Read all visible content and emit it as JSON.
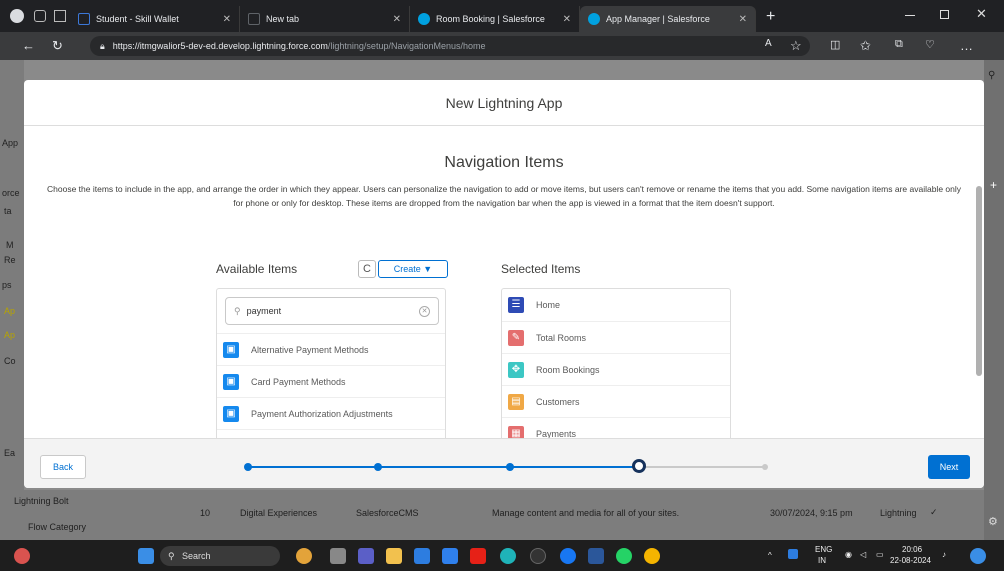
{
  "browser": {
    "tabs": [
      {
        "title": "Student - Skill Wallet",
        "color": "#3c78d8"
      },
      {
        "title": "New tab",
        "color": "#5f6368"
      },
      {
        "title": "Room Booking | Salesforce",
        "color": "#00a1e0"
      },
      {
        "title": "App Manager | Salesforce",
        "color": "#00a1e0"
      }
    ],
    "new_tab": "+",
    "url_host": "https://itmgwalior5-dev-ed.develop.lightning.force.com",
    "url_path": "/lightning/setup/NavigationMenus/home"
  },
  "modal": {
    "title": "New Lightning App",
    "section_title": "Navigation Items",
    "description": "Choose the items to include in the app, and arrange the order in which they appear. Users can personalize the navigation to add or move items, but users can't remove or rename the items that you add. Some navigation items are available only for phone or only for desktop. These items are dropped from the navigation bar when the app is viewed in a format that the item doesn't support.",
    "available_label": "Available Items",
    "refresh_glyph": "C",
    "create_label": "Create ▼",
    "search_value": "payment",
    "available_items": [
      {
        "label": "Alternative Payment Methods",
        "color": "#1589ee"
      },
      {
        "label": "Card Payment Methods",
        "color": "#1589ee"
      },
      {
        "label": "Payment Authorization Adjustments",
        "color": "#1589ee"
      }
    ],
    "selected_label": "Selected Items",
    "selected_items": [
      {
        "label": "Home",
        "color": "#2e4bb5",
        "glyph": "☰"
      },
      {
        "label": "Total Rooms",
        "color": "#e46e6e",
        "glyph": "✎"
      },
      {
        "label": "Room Bookings",
        "color": "#3cc7c4",
        "glyph": "✥"
      },
      {
        "label": "Customers",
        "color": "#f0a845",
        "glyph": "▤"
      },
      {
        "label": "Payments",
        "color": "#e46e6e",
        "glyph": "▦"
      }
    ],
    "back_label": "Back",
    "next_label": "Next"
  },
  "background": {
    "left_labels": [
      "App",
      "orce",
      "ta",
      "M",
      "Re",
      "ps",
      "Ap",
      "Ap",
      "Co",
      "Ea"
    ],
    "lightning_bolt": "Lightning Bolt",
    "flow_category": "Flow Category",
    "row_num": "10",
    "row_name": "Digital Experiences",
    "row_dev": "SalesforceCMS",
    "row_desc": "Manage content and media for all of your sites.",
    "row_date": "30/07/2024, 9:15 pm",
    "row_type": "Lightning",
    "row_check": "✓"
  },
  "taskbar": {
    "search": "Search",
    "lang": "ENG",
    "region": "IN",
    "time": "20:06",
    "date": "22-08-2024"
  }
}
